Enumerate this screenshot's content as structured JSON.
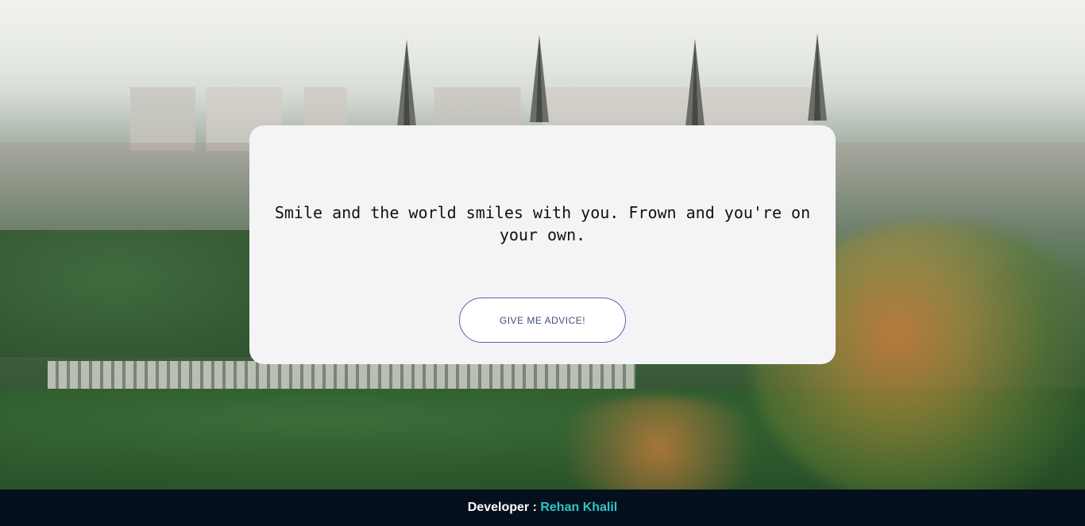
{
  "advice": {
    "text": "Smile and the world smiles with you. Frown and you're on your own.",
    "button_label": "GIVE ME ADVICE!"
  },
  "footer": {
    "label": "Developer : ",
    "developer_name": "Rehan Khalil"
  },
  "colors": {
    "card_background": "#f4f4f6",
    "button_border": "#5566aa",
    "footer_background": "#05101d",
    "footer_name": "#2ec4c9"
  }
}
